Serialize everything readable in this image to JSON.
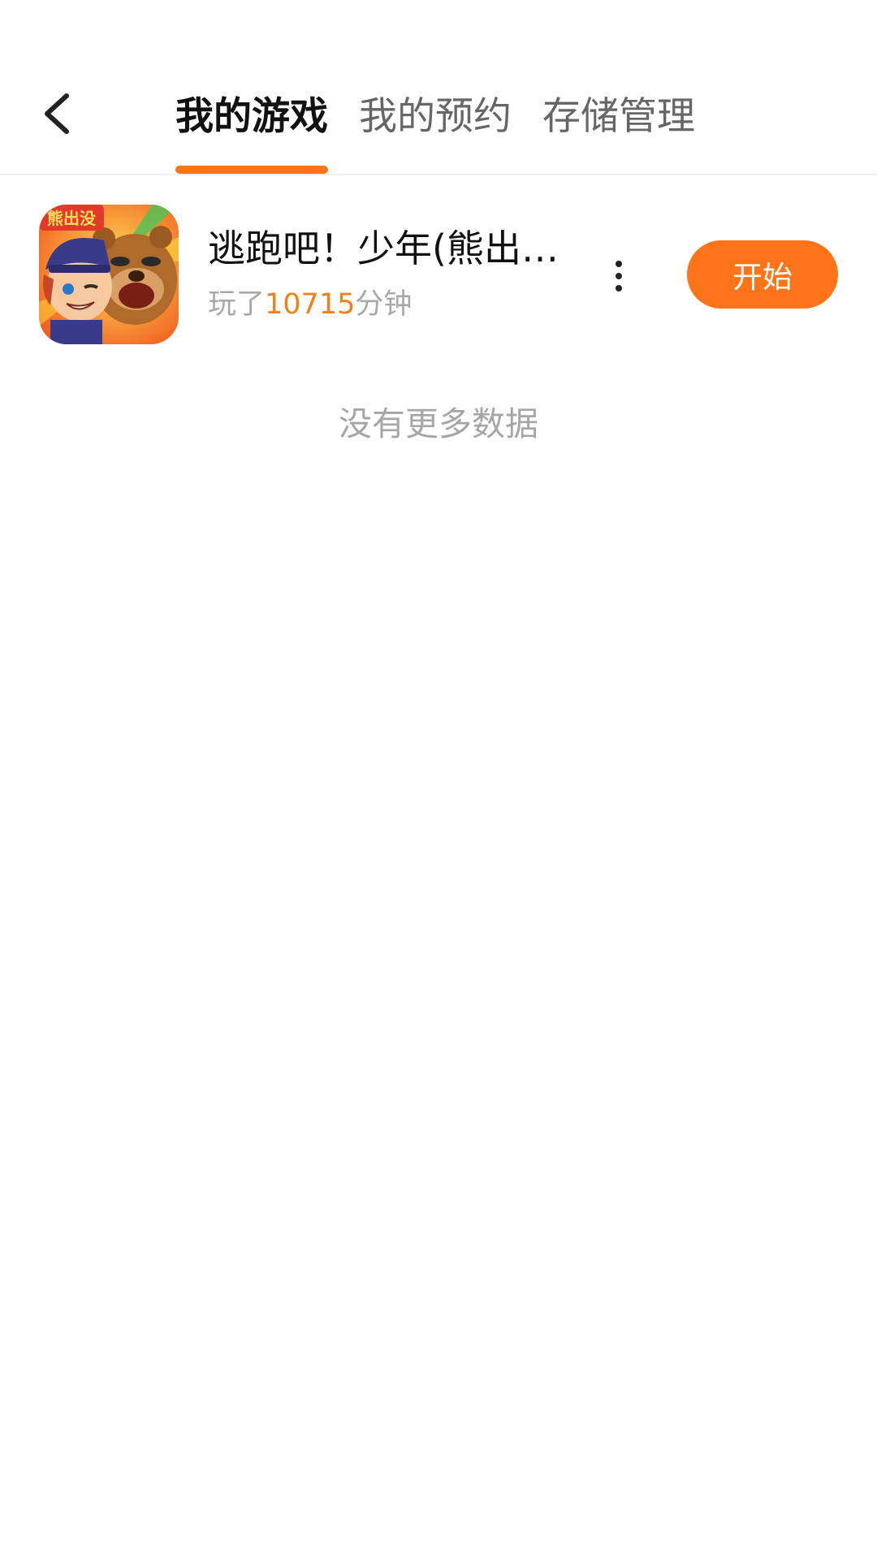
{
  "header": {
    "back_icon": "chevron-left-icon",
    "tabs": [
      {
        "label": "我的游戏",
        "active": true
      },
      {
        "label": "我的预约",
        "active": false
      },
      {
        "label": "存储管理",
        "active": false
      }
    ],
    "accent_color": "#ff7418"
  },
  "games": [
    {
      "title": "逃跑吧！少年(熊出…",
      "played_prefix": "玩了",
      "played_minutes": "10715",
      "played_suffix": "分钟",
      "icon_text": "熊出没",
      "more_icon": "more-vertical-icon",
      "start_label": "开始"
    }
  ],
  "footer": {
    "no_more_text": "没有更多数据"
  }
}
